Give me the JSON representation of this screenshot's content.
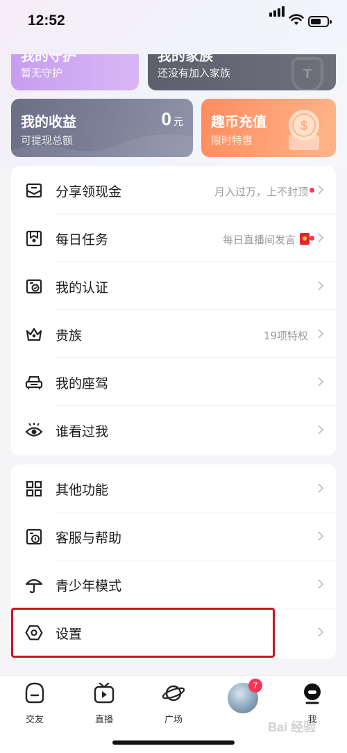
{
  "status_bar": {
    "time": "12:52"
  },
  "top_cards": {
    "guard": {
      "title": "我的守护",
      "subtitle": "暂无守护"
    },
    "family": {
      "title": "我的家族",
      "subtitle": "还没有加入家族",
      "badge": "T"
    }
  },
  "earnings": {
    "title": "我的收益",
    "subtitle": "可提现总额",
    "amount": "0",
    "unit": "元"
  },
  "recharge": {
    "title": "趣币充值",
    "subtitle": "限时特惠"
  },
  "menu_main": [
    {
      "label": "分享领现金",
      "sub": "月入过万，上不封顶",
      "dot": true,
      "icon": "share-cash-icon"
    },
    {
      "label": "每日任务",
      "sub": "每日直播间发言",
      "dot": true,
      "icon": "daily-task-icon"
    },
    {
      "label": "我的认证",
      "sub": "",
      "dot": false,
      "icon": "verify-icon"
    },
    {
      "label": "贵族",
      "sub": "19项特权",
      "dot": false,
      "icon": "crown-icon"
    },
    {
      "label": "我的座驾",
      "sub": "",
      "dot": false,
      "icon": "car-icon"
    },
    {
      "label": "谁看过我",
      "sub": "",
      "dot": false,
      "icon": "eye-icon"
    }
  ],
  "menu_other": [
    {
      "label": "其他功能",
      "icon": "grid-icon"
    },
    {
      "label": "客服与帮助",
      "icon": "help-icon"
    },
    {
      "label": "青少年模式",
      "icon": "umbrella-icon"
    },
    {
      "label": "设置",
      "icon": "settings-icon"
    }
  ],
  "bottom_nav": [
    {
      "label": "交友",
      "icon": "friends-icon"
    },
    {
      "label": "直播",
      "icon": "live-tv-icon"
    },
    {
      "label": "广场",
      "icon": "planet-icon"
    },
    {
      "label": "",
      "icon": "avatar",
      "badge": "7"
    },
    {
      "label": "我",
      "icon": "me-icon"
    }
  ],
  "watermark": "Bai 经验",
  "colors": {
    "accent_red": "#ff3355",
    "highlight_box": "#d0121f",
    "recharge_orange": "#ff8d5e"
  }
}
